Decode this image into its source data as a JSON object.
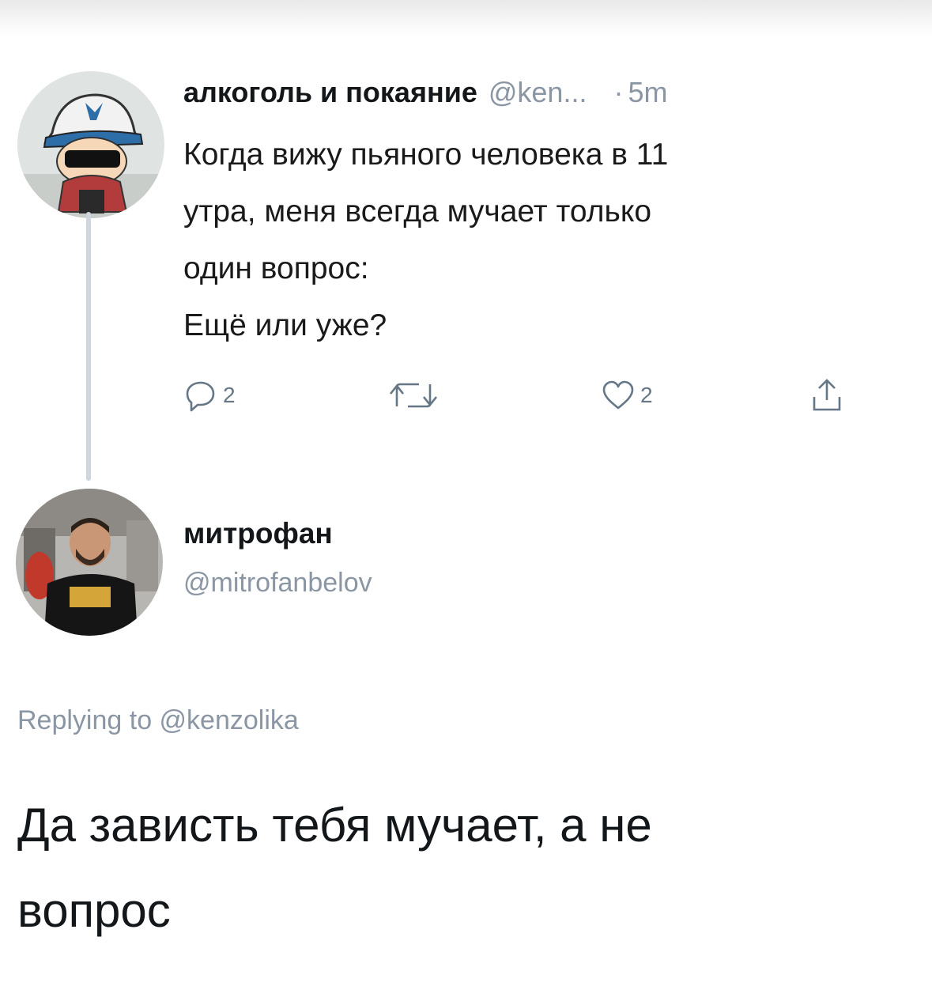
{
  "parent_tweet": {
    "author_name": "алкоголь и покаяние",
    "author_handle": "@ken...",
    "separator": "·",
    "time": "5m",
    "text_lines": [
      "Когда вижу пьяного человека в 11",
      "утра, меня всегда мучает только",
      "один вопрос:",
      "Ещё или уже?"
    ],
    "actions": {
      "reply_count": "2",
      "like_count": "2"
    }
  },
  "reply_tweet": {
    "author_name": "митрофан",
    "author_handle": "@mitrofanbelov",
    "replying_to": "Replying to @kenzolika",
    "text_lines": [
      "Да зависть тебя мучает, а не",
      "вопрос"
    ]
  },
  "icons": {
    "reply": "reply-icon",
    "retweet": "retweet-icon",
    "like": "like-icon",
    "share": "share-icon"
  },
  "colors": {
    "text": "#14171a",
    "muted": "#8a96a3",
    "thread_line": "#cfd6dc"
  }
}
